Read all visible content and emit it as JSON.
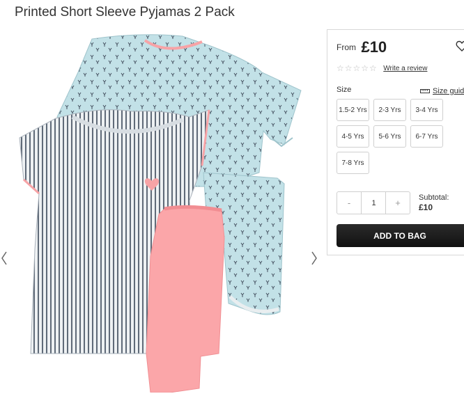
{
  "product": {
    "title": "Printed Short Sleeve Pyjamas 2 Pack"
  },
  "pricing": {
    "from_label": "From",
    "price": "£10"
  },
  "rating": {
    "stars_icon": "star-outline-icon",
    "review_link": "Write a review"
  },
  "size": {
    "label": "Size",
    "guide_label": "Size guide",
    "options": [
      "1.5-2 Yrs",
      "2-3 Yrs",
      "3-4 Yrs",
      "4-5 Yrs",
      "5-6 Yrs",
      "6-7 Yrs",
      "7-8 Yrs"
    ]
  },
  "quantity": {
    "minus": "-",
    "value": "1",
    "plus": "+"
  },
  "subtotal": {
    "label": "Subtotal:",
    "amount": "£10"
  },
  "actions": {
    "add_to_bag": "ADD TO BAG"
  },
  "colors": {
    "pink": "#f9a3a6",
    "light_blue": "#bfe0e6",
    "stripe": "#54606e",
    "button": "#1a1a1a"
  }
}
